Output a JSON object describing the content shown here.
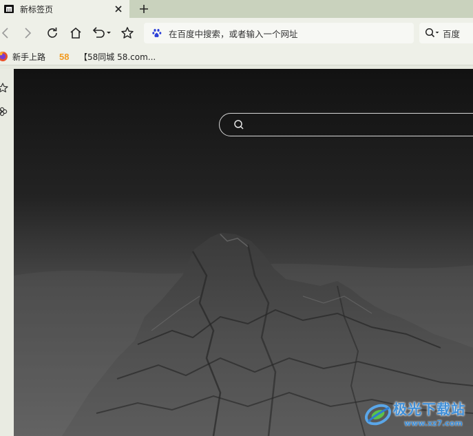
{
  "tab": {
    "title": "新标签页",
    "favicon": "maxthon-logo-icon"
  },
  "toolbar": {
    "icons": [
      "back-icon",
      "forward-icon",
      "refresh-icon",
      "home-icon",
      "undo-icon",
      "favorite-star-icon"
    ]
  },
  "address_bar": {
    "placeholder": "在百度中搜索，或者输入一个网址",
    "engine_icon": "baidu-paw-icon"
  },
  "search_box": {
    "engine_label": "百度"
  },
  "bookmarks": [
    {
      "label": "新手上路",
      "icon": "firefox-icon"
    },
    {
      "label": "",
      "icon": "58-logo-icon"
    },
    {
      "label": "【58同城 58.com...",
      "icon": ""
    }
  ],
  "bookmark_58_text": "58",
  "side_panel": {
    "icons": [
      "favorites-star-icon",
      "settings-flower-icon"
    ]
  },
  "ntp_search": {
    "value": ""
  },
  "watermark": {
    "title": "极光下载站",
    "url": "www.xz7.com"
  },
  "colors": {
    "tabstrip": "#c9d2bd",
    "toolbar": "#eef0e8",
    "content_top": "#141414",
    "accent": "#3f8fd8"
  }
}
